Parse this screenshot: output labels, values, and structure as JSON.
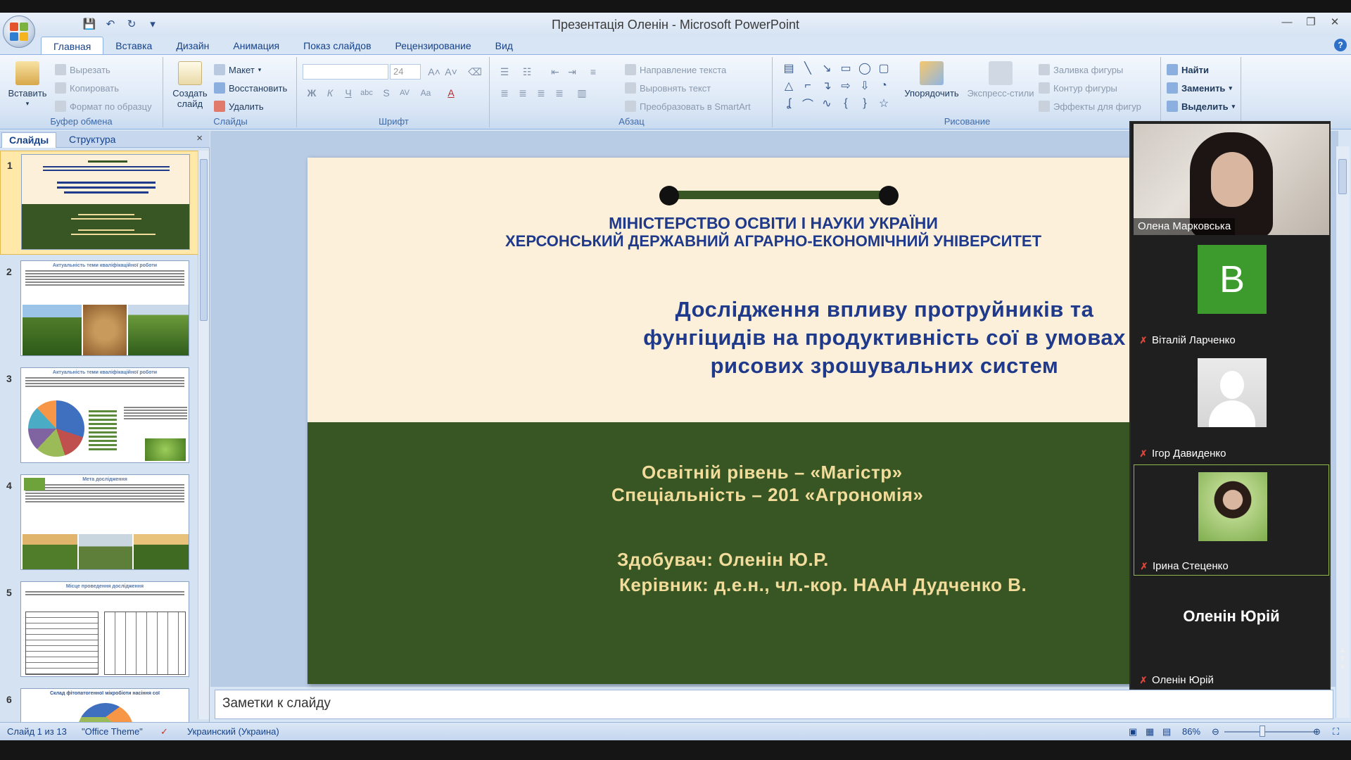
{
  "window": {
    "title": "Презентація Оленін - Microsoft PowerPoint"
  },
  "tabs": [
    "Главная",
    "Вставка",
    "Дизайн",
    "Анимация",
    "Показ слайдов",
    "Рецензирование",
    "Вид"
  ],
  "ribbon": {
    "clipboard": {
      "label": "Буфер обмена",
      "paste": "Вставить",
      "cut": "Вырезать",
      "copy": "Копировать",
      "format_painter": "Формат по образцу"
    },
    "slides": {
      "label": "Слайды",
      "new_slide": "Создать слайд",
      "layout": "Макет",
      "reset": "Восстановить",
      "delete": "Удалить"
    },
    "font": {
      "label": "Шрифт",
      "size": "24"
    },
    "paragraph": {
      "label": "Абзац",
      "text_direction": "Направление текста",
      "align_text": "Выровнять текст",
      "smartart": "Преобразовать в SmartArt"
    },
    "drawing": {
      "label": "Рисование",
      "arrange": "Упорядочить",
      "quick_styles": "Экспресс-стили",
      "shape_fill": "Заливка фигуры",
      "shape_outline": "Контур фигуры",
      "shape_effects": "Эффекты для фигур"
    },
    "editing": {
      "find": "Найти",
      "replace": "Заменить",
      "select": "Выделить"
    }
  },
  "left_panel": {
    "tab_slides": "Слайды",
    "tab_outline": "Структура",
    "close": "×",
    "slide_numbers": [
      "1",
      "2",
      "3",
      "4",
      "5",
      "6"
    ],
    "thumb_titles": [
      "",
      "Актуальність теми кваліфікаційної роботи",
      "Актуальність теми кваліфікаційної роботи",
      "Мета дослідження",
      "Місце проведення дослідження",
      "Склад фітопатогенної мікробіоти насіння сої"
    ]
  },
  "slide": {
    "line1": "МІНІСТЕРСТВО ОСВІТИ І НАУКИ УКРАЇНИ",
    "line2": "ХЕРСОНСЬКИЙ ДЕРЖАВНИЙ АГРАРНО-ЕКОНОМІЧНИЙ УНІВЕРСИТЕТ",
    "title_l1": "Дослідження впливу протруйників та",
    "title_l2": "фунгіцидів на продуктивність сої в умовах",
    "title_l3": "рисових зрошувальних систем",
    "level": "Освітній рівень – «Магістр»",
    "specialty": "Спеціальність – 201 «Агрономія»",
    "applicant": "Здобувач: Оленін Ю.Р.",
    "supervisor": "Керівник: д.е.н., чл.-кор. НААН Дудченко В."
  },
  "notes_placeholder": "Заметки к слайду",
  "statusbar": {
    "slide_info": "Слайд 1 из 13",
    "theme": "\"Office Theme\"",
    "language": "Украинский (Украина)",
    "zoom": "86%"
  },
  "participants": [
    {
      "name": "Олена Марковська",
      "type": "video"
    },
    {
      "name": "Віталій Ларченко",
      "initial": "B",
      "type": "initial"
    },
    {
      "name": "Ігор Давиденко",
      "type": "silhouette"
    },
    {
      "name": "Ірина Стеценко",
      "type": "photo"
    },
    {
      "name": "Оленін Юрій",
      "display": "Оленін Юрій",
      "type": "text"
    }
  ],
  "colors": {
    "slide_cream": "#fdf0da",
    "slide_green": "#375623",
    "title_blue": "#1f3a8a",
    "gold_text": "#f2dc9b",
    "avatar_green": "#3d9a2c"
  }
}
